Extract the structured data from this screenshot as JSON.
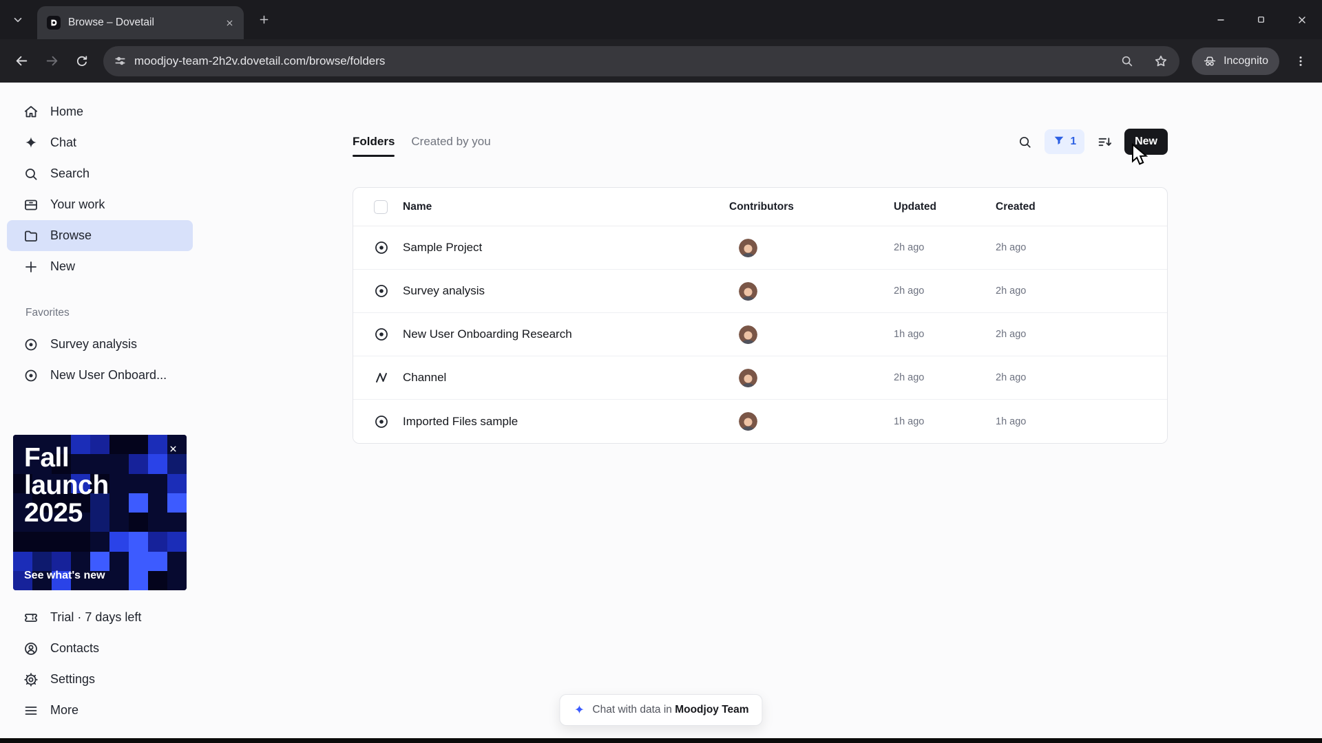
{
  "browser": {
    "tab_title": "Browse – Dovetail",
    "url": "moodjoy-team-2h2v.dovetail.com/browse/folders",
    "incognito_label": "Incognito"
  },
  "sidebar": {
    "items": [
      {
        "label": "Home"
      },
      {
        "label": "Chat"
      },
      {
        "label": "Search"
      },
      {
        "label": "Your work"
      },
      {
        "label": "Browse"
      },
      {
        "label": "New"
      }
    ],
    "favorites_label": "Favorites",
    "favorites": [
      {
        "label": "Survey analysis"
      },
      {
        "label": "New User Onboard..."
      }
    ],
    "promo": {
      "title": "Fall launch 2025",
      "cta": "See what's new"
    },
    "footer": [
      {
        "label": "Trial · 7 days left"
      },
      {
        "label": "Contacts"
      },
      {
        "label": "Settings"
      },
      {
        "label": "More"
      }
    ]
  },
  "main": {
    "tabs": [
      {
        "label": "Folders"
      },
      {
        "label": "Created by you"
      }
    ],
    "controls": {
      "filter_badge": "1",
      "new_label": "New"
    },
    "table": {
      "headers": {
        "name": "Name",
        "contributors": "Contributors",
        "updated": "Updated",
        "created": "Created"
      },
      "rows": [
        {
          "name": "Sample Project",
          "updated": "2h ago",
          "created": "2h ago"
        },
        {
          "name": "Survey analysis",
          "updated": "2h ago",
          "created": "2h ago"
        },
        {
          "name": "New User Onboarding Research",
          "updated": "1h ago",
          "created": "2h ago"
        },
        {
          "name": "Channel",
          "updated": "2h ago",
          "created": "2h ago"
        },
        {
          "name": "Imported Files sample",
          "updated": "1h ago",
          "created": "1h ago"
        }
      ]
    },
    "chat_pill": {
      "prefix": "Chat with data in",
      "team": "Moodjoy Team"
    }
  }
}
